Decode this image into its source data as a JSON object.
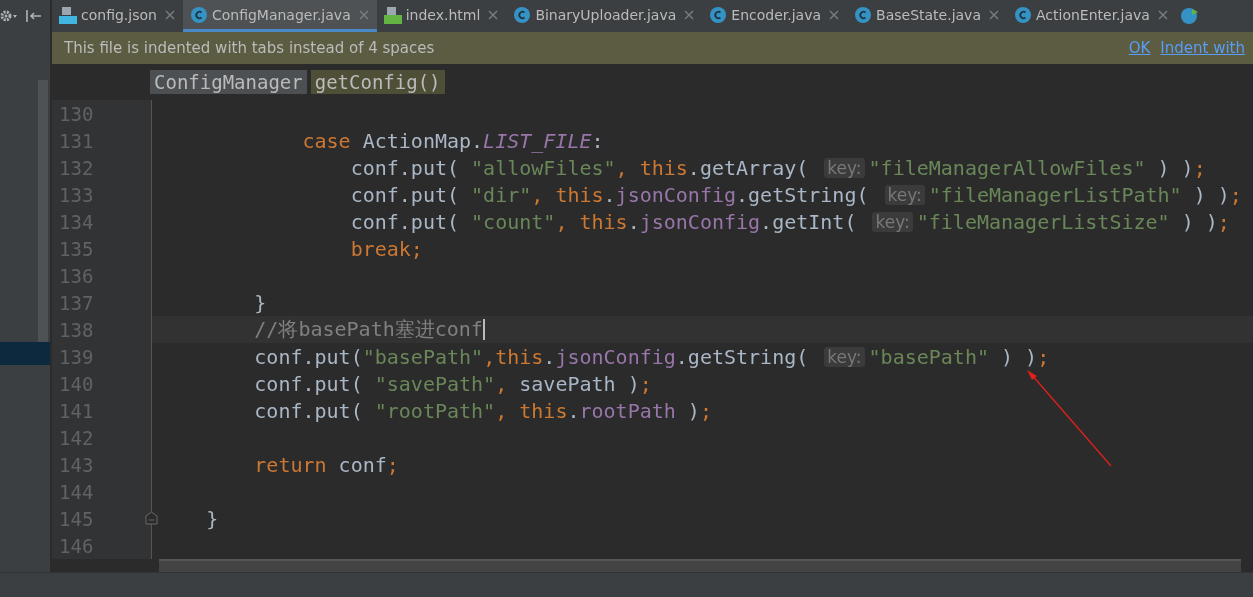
{
  "tabs": [
    {
      "label": "config.json",
      "kind": "json",
      "selected": false
    },
    {
      "label": "ConfigManager.java",
      "kind": "class",
      "selected": true
    },
    {
      "label": "index.html",
      "kind": "html",
      "selected": false
    },
    {
      "label": "BinaryUploader.java",
      "kind": "class",
      "selected": false
    },
    {
      "label": "Encoder.java",
      "kind": "class",
      "selected": false
    },
    {
      "label": "BaseState.java",
      "kind": "class",
      "selected": false
    },
    {
      "label": "ActionEnter.java",
      "kind": "class",
      "selected": false
    }
  ],
  "notice": {
    "text": "This file is indented with tabs instead of 4 spaces",
    "links": [
      "OK",
      "Indent with"
    ]
  },
  "breadcrumbs": [
    {
      "label": "ConfigManager",
      "kind": "class"
    },
    {
      "label": "getConfig()",
      "kind": "method"
    }
  ],
  "lines": [
    {
      "number": "130",
      "current": false,
      "fold_end": false
    },
    {
      "number": "131",
      "current": false,
      "fold_end": false,
      "tokens": [
        {
          "kind": "kw",
          "text": "            case"
        },
        {
          "kind": "plain",
          "text": " ActionMap."
        },
        {
          "kind": "static",
          "text": "LIST_FILE"
        },
        {
          "kind": "plain",
          "text": ":"
        }
      ]
    },
    {
      "number": "132",
      "current": false,
      "fold_end": false,
      "tokens": [
        {
          "kind": "plain",
          "text": "                conf.put( "
        },
        {
          "kind": "str",
          "text": "\"allowFiles\""
        },
        {
          "kind": "kw",
          "text": ", "
        },
        {
          "kind": "kw",
          "text": "this"
        },
        {
          "kind": "plain",
          "text": ".getArray( "
        },
        {
          "kind": "hint",
          "text": "key:"
        },
        {
          "kind": "str",
          "text": "\"fileManagerAllowFiles\""
        },
        {
          "kind": "plain",
          "text": " ) )"
        },
        {
          "kind": "kw",
          "text": ";"
        }
      ]
    },
    {
      "number": "133",
      "current": false,
      "fold_end": false,
      "tokens": [
        {
          "kind": "plain",
          "text": "                conf.put( "
        },
        {
          "kind": "str",
          "text": "\"dir\""
        },
        {
          "kind": "kw",
          "text": ", "
        },
        {
          "kind": "kw",
          "text": "this"
        },
        {
          "kind": "plain",
          "text": "."
        },
        {
          "kind": "field",
          "text": "jsonConfig"
        },
        {
          "kind": "plain",
          "text": ".getString( "
        },
        {
          "kind": "hint",
          "text": "key:"
        },
        {
          "kind": "str",
          "text": "\"fileManagerListPath\""
        },
        {
          "kind": "plain",
          "text": " ) )"
        },
        {
          "kind": "kw",
          "text": ";"
        }
      ]
    },
    {
      "number": "134",
      "current": false,
      "fold_end": false,
      "tokens": [
        {
          "kind": "plain",
          "text": "                conf.put( "
        },
        {
          "kind": "str",
          "text": "\"count\""
        },
        {
          "kind": "kw",
          "text": ", "
        },
        {
          "kind": "kw",
          "text": "this"
        },
        {
          "kind": "plain",
          "text": "."
        },
        {
          "kind": "field",
          "text": "jsonConfig"
        },
        {
          "kind": "plain",
          "text": ".getInt( "
        },
        {
          "kind": "hint",
          "text": "key:"
        },
        {
          "kind": "str",
          "text": "\"fileManagerListSize\""
        },
        {
          "kind": "plain",
          "text": " ) )"
        },
        {
          "kind": "kw",
          "text": ";"
        }
      ]
    },
    {
      "number": "135",
      "current": false,
      "fold_end": false,
      "tokens": [
        {
          "kind": "kw",
          "text": "                break;"
        }
      ]
    },
    {
      "number": "136",
      "current": false,
      "fold_end": false
    },
    {
      "number": "137",
      "current": false,
      "fold_end": false,
      "tokens": [
        {
          "kind": "plain",
          "text": "        }"
        }
      ]
    },
    {
      "number": "138",
      "current": true,
      "fold_end": false,
      "tokens": [
        {
          "kind": "comment",
          "text": "        //将basePath塞进conf"
        }
      ]
    },
    {
      "number": "139",
      "current": false,
      "fold_end": false,
      "tokens": [
        {
          "kind": "plain",
          "text": "        conf.put("
        },
        {
          "kind": "str",
          "text": "\"basePath\""
        },
        {
          "kind": "kw",
          "text": ","
        },
        {
          "kind": "kw",
          "text": "this"
        },
        {
          "kind": "plain",
          "text": "."
        },
        {
          "kind": "field",
          "text": "jsonConfig"
        },
        {
          "kind": "plain",
          "text": ".getString( "
        },
        {
          "kind": "hint",
          "text": "key:"
        },
        {
          "kind": "str",
          "text": "\"basePath\""
        },
        {
          "kind": "plain",
          "text": " ) )"
        },
        {
          "kind": "kw",
          "text": ";"
        }
      ]
    },
    {
      "number": "140",
      "current": false,
      "fold_end": false,
      "tokens": [
        {
          "kind": "plain",
          "text": "        conf.put( "
        },
        {
          "kind": "str",
          "text": "\"savePath\""
        },
        {
          "kind": "kw",
          "text": ", "
        },
        {
          "kind": "plain",
          "text": "savePath )"
        },
        {
          "kind": "kw",
          "text": ";"
        }
      ]
    },
    {
      "number": "141",
      "current": false,
      "fold_end": false,
      "tokens": [
        {
          "kind": "plain",
          "text": "        conf.put( "
        },
        {
          "kind": "str",
          "text": "\"rootPath\""
        },
        {
          "kind": "kw",
          "text": ", "
        },
        {
          "kind": "kw",
          "text": "this"
        },
        {
          "kind": "plain",
          "text": "."
        },
        {
          "kind": "field",
          "text": "rootPath"
        },
        {
          "kind": "plain",
          "text": " )"
        },
        {
          "kind": "kw",
          "text": ";"
        }
      ]
    },
    {
      "number": "142",
      "current": false,
      "fold_end": false
    },
    {
      "number": "143",
      "current": false,
      "fold_end": false,
      "tokens": [
        {
          "kind": "kw",
          "text": "        return"
        },
        {
          "kind": "plain",
          "text": " conf"
        },
        {
          "kind": "kw",
          "text": ";"
        }
      ]
    },
    {
      "number": "144",
      "current": false,
      "fold_end": false
    },
    {
      "number": "145",
      "current": false,
      "fold_end": true,
      "tokens": [
        {
          "kind": "plain",
          "text": "    }"
        }
      ]
    },
    {
      "number": "146",
      "current": false,
      "fold_end": false
    }
  ]
}
